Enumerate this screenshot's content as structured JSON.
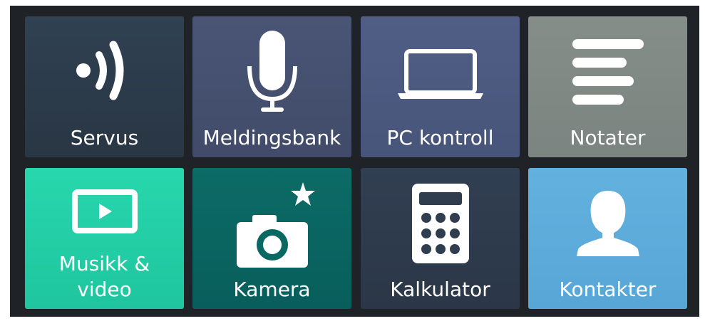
{
  "tiles": [
    {
      "label": "Servus",
      "icon": "broadcast-icon",
      "color": "#2e3e4f"
    },
    {
      "label": "Meldingsbank",
      "icon": "microphone-icon",
      "color": "#475273"
    },
    {
      "label": "PC kontroll",
      "icon": "laptop-icon",
      "color": "#4e5b82"
    },
    {
      "label": "Notater",
      "icon": "notes-icon",
      "color": "#818a86"
    },
    {
      "label_line1": "Musikk &",
      "label_line2": "video",
      "icon": "play-video-icon",
      "color": "#24d0a8"
    },
    {
      "label": "Kamera",
      "icon": "camera-icon",
      "color": "#0a6762"
    },
    {
      "label": "Kalkulator",
      "icon": "calculator-icon",
      "color": "#2f3d4f"
    },
    {
      "label": "Kontakter",
      "icon": "person-icon",
      "color": "#5eaedb"
    }
  ]
}
